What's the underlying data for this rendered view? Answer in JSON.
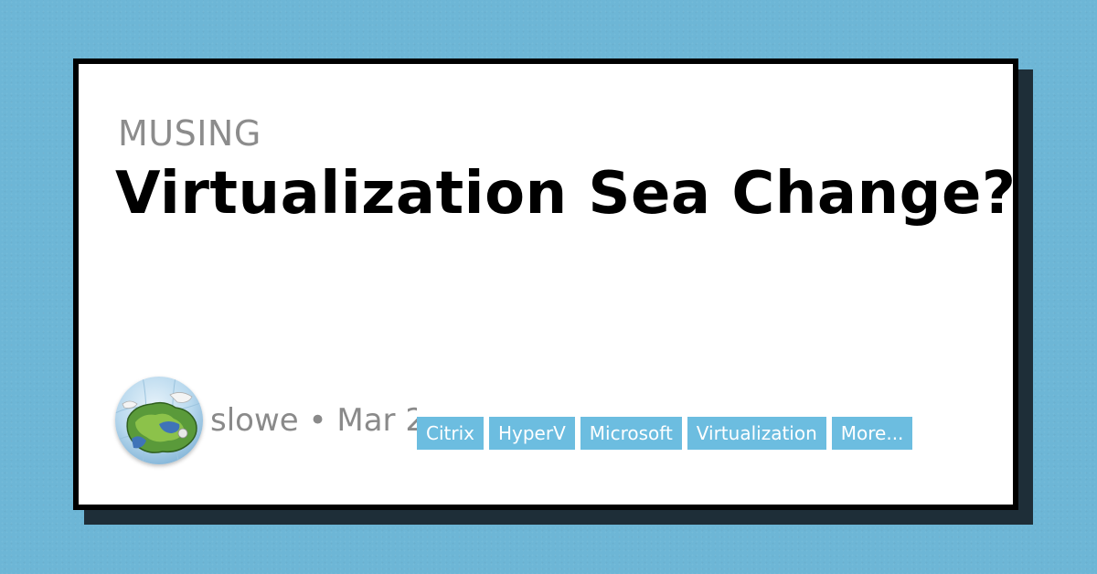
{
  "post": {
    "category": "MUSING",
    "title": "Virtualization Sea Change?",
    "author": "slowe",
    "separator": "•",
    "date": "Mar 2",
    "tags": [
      "Citrix",
      "HyperV",
      "Microsoft",
      "Virtualization",
      "More..."
    ]
  },
  "colors": {
    "background": "#6db6d6",
    "tag_background": "#6cbde0",
    "card_border": "#000000",
    "card_shadow": "#1e2e38"
  },
  "icons": {
    "avatar": "globe-avatar-icon"
  }
}
